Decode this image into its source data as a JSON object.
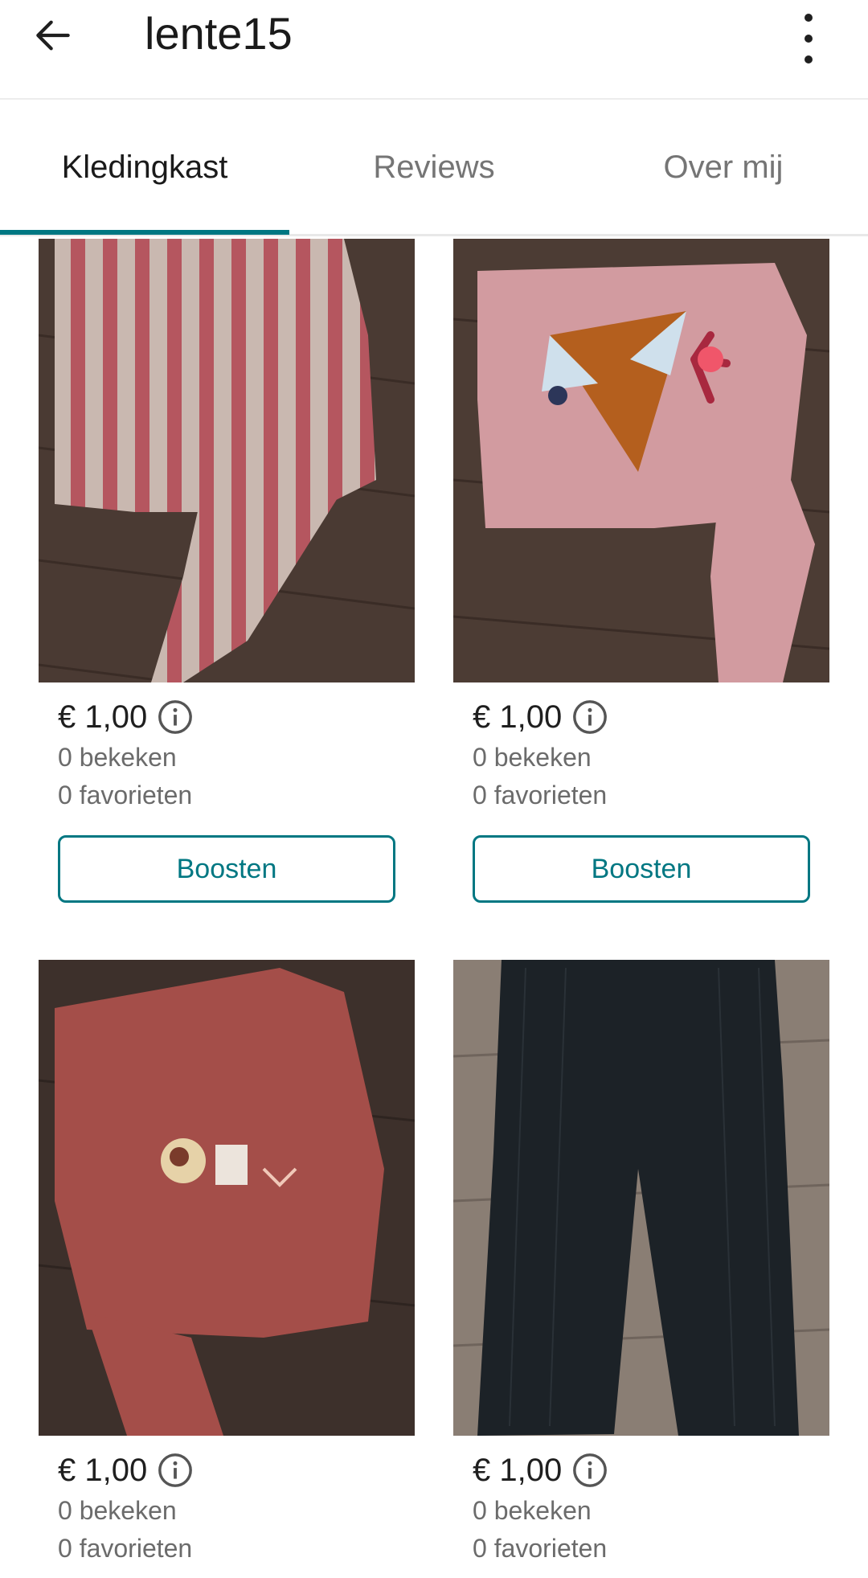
{
  "header": {
    "title": "lente15",
    "back_icon": "arrow-left-icon",
    "menu_icon": "more-vertical-icon"
  },
  "tabs": [
    {
      "label": "Kledingkast",
      "active": true
    },
    {
      "label": "Reviews",
      "active": false
    },
    {
      "label": "Over mij",
      "active": false
    }
  ],
  "colors": {
    "accent": "#007782"
  },
  "items": [
    {
      "price": "€ 1,00",
      "views": "0 bekeken",
      "favorites": "0 favorieten",
      "button": "Boosten"
    },
    {
      "price": "€ 1,00",
      "views": "0 bekeken",
      "favorites": "0 favorieten",
      "button": "Boosten"
    },
    {
      "price": "€ 1,00",
      "views": "0 bekeken",
      "favorites": "0 favorieten"
    },
    {
      "price": "€ 1,00",
      "views": "0 bekeken",
      "favorites": "0 favorieten"
    }
  ]
}
